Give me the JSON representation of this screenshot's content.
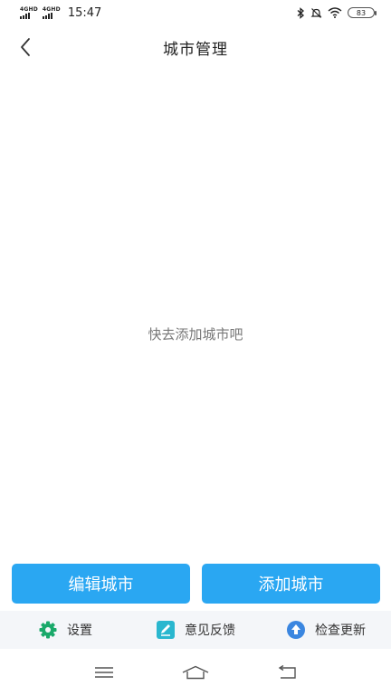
{
  "status_bar": {
    "network_1": "4GHD",
    "network_2": "4GHD",
    "time": "15:47",
    "battery": "83"
  },
  "header": {
    "title": "城市管理"
  },
  "main": {
    "empty_hint": "快去添加城市吧"
  },
  "actions": {
    "edit_label": "编辑城市",
    "add_label": "添加城市",
    "accent_color": "#2aa7f2"
  },
  "bottom_nav": {
    "items": [
      {
        "label": "设置",
        "icon": "gear-icon",
        "color": "#1aa96a"
      },
      {
        "label": "意见反馈",
        "icon": "edit-icon",
        "color": "#2ab7cf"
      },
      {
        "label": "检查更新",
        "icon": "upload-icon",
        "color": "#3a86e0"
      }
    ]
  }
}
